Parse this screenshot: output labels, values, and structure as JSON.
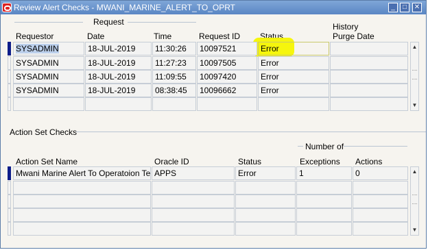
{
  "window": {
    "title": "Review Alert Checks - MWANI_MARINE_ALERT_TO_OPRT",
    "minimize_glyph": "_",
    "maximize_glyph": "□",
    "close_glyph": "✕"
  },
  "request_section": {
    "group_label": "Request",
    "history_label": "History",
    "columns": {
      "requestor": "Requestor",
      "date": "Date",
      "time": "Time",
      "request_id": "Request ID",
      "status": "Status",
      "purge_date": "Purge Date"
    },
    "rows": [
      {
        "requestor": "SYSADMIN",
        "date": "18-JUL-2019",
        "time": "11:30:26",
        "request_id": "10097521",
        "status": "Error",
        "purge_date": ""
      },
      {
        "requestor": "SYSADMIN",
        "date": "18-JUL-2019",
        "time": "11:27:23",
        "request_id": "10097505",
        "status": "Error",
        "purge_date": ""
      },
      {
        "requestor": "SYSADMIN",
        "date": "18-JUL-2019",
        "time": "11:09:55",
        "request_id": "10097420",
        "status": "Error",
        "purge_date": ""
      },
      {
        "requestor": "SYSADMIN",
        "date": "18-JUL-2019",
        "time": "08:38:45",
        "request_id": "10096662",
        "status": "Error",
        "purge_date": ""
      },
      {
        "requestor": "",
        "date": "",
        "time": "",
        "request_id": "",
        "status": "",
        "purge_date": ""
      }
    ]
  },
  "action_set_section": {
    "title": "Action Set Checks",
    "number_of_label": "Number of",
    "columns": {
      "action_set_name": "Action Set Name",
      "oracle_id": "Oracle ID",
      "status": "Status",
      "exceptions": "Exceptions",
      "actions": "Actions"
    },
    "rows": [
      {
        "action_set_name": "Mwani Marine Alert To Operatoion Team",
        "oracle_id": "APPS",
        "status": "Error",
        "exceptions": "1",
        "actions": "0"
      },
      {
        "action_set_name": "",
        "oracle_id": "",
        "status": "",
        "exceptions": "",
        "actions": ""
      },
      {
        "action_set_name": "",
        "oracle_id": "",
        "status": "",
        "exceptions": "",
        "actions": ""
      },
      {
        "action_set_name": "",
        "oracle_id": "",
        "status": "",
        "exceptions": "",
        "actions": ""
      },
      {
        "action_set_name": "",
        "oracle_id": "",
        "status": "",
        "exceptions": "",
        "actions": ""
      }
    ]
  },
  "highlight_color": "#f5f500",
  "selection_color": "#bcd0ec"
}
